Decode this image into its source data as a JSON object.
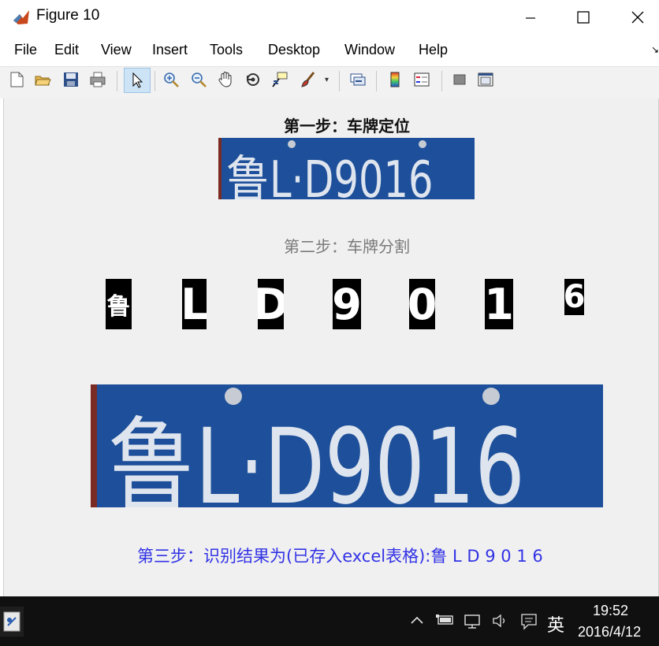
{
  "window": {
    "title": "Figure 10"
  },
  "menu": [
    "File",
    "Edit",
    "View",
    "Insert",
    "Tools",
    "Desktop",
    "Window",
    "Help"
  ],
  "toolbar_icons": [
    "new-figure-icon",
    "open-file-icon",
    "save-icon",
    "print-icon",
    "select-arrow-icon",
    "zoom-in-icon",
    "zoom-out-icon",
    "pan-hand-icon",
    "rotate-3d-icon",
    "data-cursor-icon",
    "brush-icon",
    "link-plot-icon",
    "colorbar-icon",
    "legend-icon",
    "hide-plot-tools-icon",
    "show-plot-tools-icon"
  ],
  "figure": {
    "step1_title": "第一步：车牌定位",
    "step2_title": "第二步：车牌分割",
    "plate_text": "鲁L·D9016",
    "segments": [
      "鲁",
      "L",
      "D",
      "9",
      "0",
      "1",
      "6"
    ],
    "result_text": "第三步：识别结果为(已存入excel表格):鲁 L D 9 0 1 6"
  },
  "taskbar": {
    "ime": "英",
    "time": "19:52",
    "date": "2016/4/12"
  },
  "colors": {
    "plate_blue": "#1d4f9a",
    "result_text": "#3232e6",
    "step2_text": "#7a7a7a"
  }
}
